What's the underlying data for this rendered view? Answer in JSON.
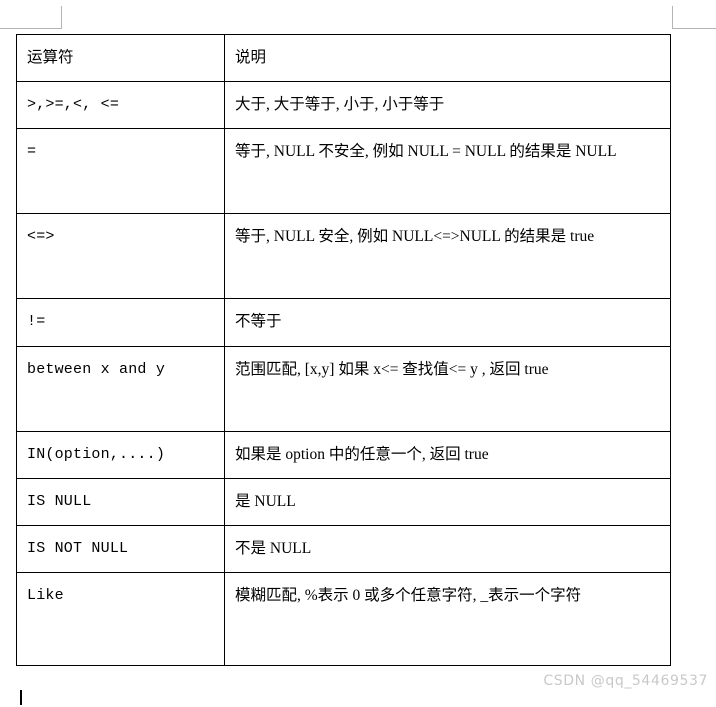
{
  "document": {
    "table": {
      "headers": [
        "运算符",
        "说明"
      ],
      "rows": [
        {
          "operator": ">,>=,<, <=",
          "description": "大于, 大于等于, 小于, 小于等于",
          "height": "normal"
        },
        {
          "operator": "=",
          "description": "等于, NULL 不安全, 例如 NULL = NULL 的结果是 NULL",
          "height": "tall"
        },
        {
          "operator": "<=>",
          "description": "等于, NULL 安全, 例如 NULL<=>NULL 的结果是 true",
          "height": "tall"
        },
        {
          "operator": "!=",
          "description": "不等于",
          "height": "normal"
        },
        {
          "operator": "between x and y",
          "description": "范围匹配, [x,y] 如果 x<= 查找值<= y , 返回 true",
          "height": "tall"
        },
        {
          "operator": "IN(option,....)",
          "description": "如果是 option 中的任意一个, 返回 true",
          "height": "normal"
        },
        {
          "operator": "IS NULL",
          "description": "是 NULL",
          "height": "normal"
        },
        {
          "operator": "IS NOT NULL",
          "description": "不是 NULL",
          "height": "normal"
        },
        {
          "operator": "Like",
          "description": "模糊匹配, %表示 0 或多个任意字符, _表示一个字符",
          "height": "xtall"
        }
      ]
    },
    "watermark": "CSDN @qq_54469537"
  }
}
